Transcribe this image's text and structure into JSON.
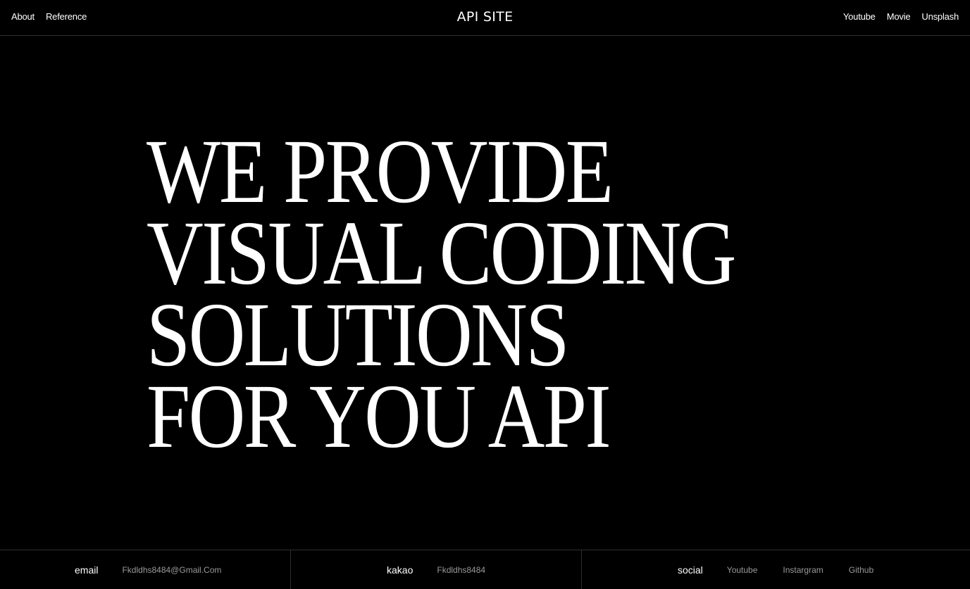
{
  "header": {
    "left_links": [
      "About",
      "Reference"
    ],
    "title": "API SITE",
    "right_links": [
      "Youtube",
      "Movie",
      "Unsplash"
    ]
  },
  "hero": {
    "lines": [
      "WE PROVIDE",
      "VISUAL CODING",
      "SOLUTIONS",
      "FOR YOU API"
    ]
  },
  "footer": {
    "email": {
      "label": "email",
      "value": "Fkdldhs8484@Gmail.Com"
    },
    "kakao": {
      "label": "kakao",
      "value": "Fkdldhs8484"
    },
    "social": {
      "label": "social",
      "links": [
        "Youtube",
        "Instargram",
        "Github"
      ]
    }
  },
  "colors": {
    "background": "#000000",
    "text": "#ffffff",
    "muted": "#9a9a9a",
    "divider": "#2e2e2e"
  }
}
